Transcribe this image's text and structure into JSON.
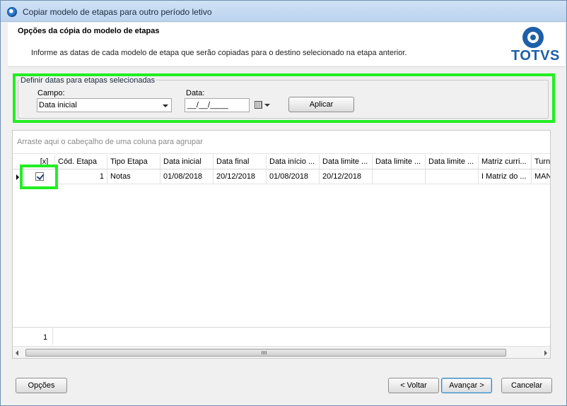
{
  "window": {
    "title": "Copiar modelo de etapas para outro período letivo"
  },
  "header": {
    "title": "Opções da cópia do modelo de etapas",
    "description": "Informe as datas de cada modelo de etapa que serão copiadas para o destino selecionado na etapa anterior.",
    "logo_text": "TOTVS"
  },
  "group": {
    "legend": "Definir datas para etapas selecionadas",
    "campo_label": "Campo:",
    "campo_value": "Data inicial",
    "data_label": "Data:",
    "data_value": "__/__/____",
    "apply_label": "Aplicar"
  },
  "grid": {
    "group_hint": "Arraste aqui o cabeçalho de uma coluna para agrupar",
    "columns": [
      "[x]",
      "Cód. Etapa",
      "Tipo Etapa",
      "Data inicial",
      "Data final",
      "Data início ...",
      "Data limite ...",
      "Data limite ...",
      "Data limite ...",
      "Matriz curri...",
      "Turno"
    ],
    "rows": [
      {
        "checked": true,
        "cod": "1",
        "tipo": "Notas",
        "data_inicial": "01/08/2018",
        "data_final": "20/12/2018",
        "data_inicio": "01/08/2018",
        "data_limite1": "20/12/2018",
        "data_limite2": "",
        "data_limite3": "",
        "matriz": "I Matriz do ...",
        "turno": "MANHÃ"
      }
    ],
    "footer_count": "1",
    "scroll_grip": "III"
  },
  "footer": {
    "options_label": "Opções",
    "back_label": "< Voltar",
    "next_label": "Avançar >",
    "cancel_label": "Cancelar"
  }
}
